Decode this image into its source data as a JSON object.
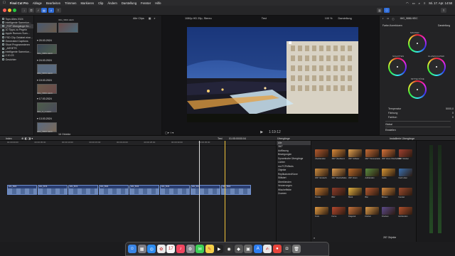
{
  "menubar": {
    "apple": "",
    "app": "Final Cut Pro",
    "menus": [
      "Ablage",
      "Bearbeiten",
      "Trimmen",
      "Markieren",
      "Clip",
      "Ändern",
      "Darstellung",
      "Fenster",
      "Hilfe"
    ],
    "clock": "Mi. 17. Apr. 14:58"
  },
  "toolbar": {
    "share_icon": "share-icon"
  },
  "libraries": {
    "items": [
      {
        "label": "Tops Alles 2024",
        "selected": false
      },
      {
        "label": "Intelligente Sammlun...",
        "selected": false
      },
      {
        "label": "_FCP Übergänge für...",
        "selected": true
      },
      {
        "label": "10 Tipps zu Pegeln",
        "selected": false
      },
      {
        "label": "Apple Rumors Sum...",
        "selected": false
      },
      {
        "label": "FSD Clip Gelabel eine...",
        "selected": false
      },
      {
        "label": "Generated Captions",
        "selected": false
      },
      {
        "label": "Short Programmieren",
        "selected": false
      },
      {
        "label": "_ASSETS",
        "selected": false
      },
      {
        "label": "Intelligente Sammlun...",
        "selected": false
      },
      {
        "label": "2.10.23",
        "selected": false
      },
      {
        "label": "Gesichter",
        "selected": false
      }
    ]
  },
  "browser": {
    "filter": "Alle Clips",
    "dates": [
      "20.03.2024",
      "24.03.2024",
      "15.03.2024",
      "17.03.2024",
      "13.03.2024"
    ],
    "clip_names": [
      "IMG_5883.HEIC",
      "IMG_5870.HEIC",
      "IMG_5866.HEIC",
      "IMG_5_4.HEIC",
      "IMG_5806.HEIC",
      "IMG_5800.HEIC"
    ],
    "clip_count": "16 Objekte"
  },
  "viewer": {
    "format": "1080p HD 25p, Stereo",
    "title": "Test",
    "zoom": "100 %",
    "view": "Darstellung",
    "timecode": "1:19:12"
  },
  "inspector": {
    "clip": "IMG_5886.HEIC",
    "effect": "Farbe-Korrekturen",
    "preset": "Darstellung",
    "wheels": [
      "MASTER",
      "SCHATTEN",
      "MITTELTÖNE",
      "GLANZLICHTER"
    ],
    "rows": [
      {
        "label": "Temperatur",
        "value": "5000,0"
      },
      {
        "label": "Färbung",
        "value": "0"
      },
      {
        "label": "Farbton",
        "value": "0"
      }
    ],
    "sections": [
      "Global",
      "Einstellen"
    ]
  },
  "timeline": {
    "index": "Index",
    "project": "Test",
    "duration": "01:05:00/00:04",
    "ruler": [
      "00:00:00:00",
      "00:00:05:00",
      "00:00:10:00",
      "00:00:15:00",
      "00:00:20:00",
      "00:00:25:00",
      "00:00:30:00",
      "00:00:35:00"
    ],
    "clips": [
      "IMG_5880",
      "IMG_5878",
      "IMG_5870",
      "IMG_5866",
      "IMG_5846",
      "IMG_5836",
      "IMG_5811",
      "IMG_5806"
    ]
  },
  "transitions": {
    "title": "Übergänge",
    "installed": "Installierte Übergänge",
    "count": "287 Objekte",
    "categories": [
      "Alle",
      "360°",
      "Auflösung",
      "Bewegungen",
      "Dynamische Übergänge",
      "Lichter",
      "mo FCPeffects",
      "Objekte",
      "Replikatoren/Klone",
      "Stilisiert",
      "Überblenden",
      "Verzerrungen",
      "Wischeffekte",
      "Zoomen"
    ],
    "items": [
      {
        "name": "Überblenden",
        "color": "#b25a2e"
      },
      {
        "name": "360° Überblend.",
        "color": "#d98a3a"
      },
      {
        "name": "360° Schleier",
        "color": "#e0a050"
      },
      {
        "name": "360° Trümmerteile",
        "color": "#c46b35"
      },
      {
        "name": "360° Zoom Wischeffekt",
        "color": "#d6733a"
      },
      {
        "name": "360° Drehen",
        "color": "#a04030"
      },
      {
        "name": "360° Verwisch.",
        "color": "#ca8b3f"
      },
      {
        "name": "360° Wischeffekte",
        "color": "#d99a4f"
      },
      {
        "name": "360° Zoom",
        "color": "#b86a2a"
      },
      {
        "name": "Aufblenden",
        "color": "#5a8a40"
      },
      {
        "name": "Audio",
        "color": "#d49535"
      },
      {
        "name": "Nach oben",
        "color": "#3a6fae"
      },
      {
        "name": "Punkte",
        "color": "#c47a32"
      },
      {
        "name": "Blitz",
        "color": "#8b3b2a"
      },
      {
        "name": "Block",
        "color": "#e2b040"
      },
      {
        "name": "Blur",
        "color": "#b55a30"
      },
      {
        "name": "Blinken",
        "color": "#d0883d"
      },
      {
        "name": "Fenster",
        "color": "#9a4a2c"
      },
      {
        "name": "Kreis",
        "color": "#e09a42"
      },
      {
        "name": "Kurve",
        "color": "#b5482e"
      },
      {
        "name": "Diagonal",
        "color": "#c6733b"
      },
      {
        "name": "Drehen",
        "color": "#da9a4a"
      },
      {
        "name": "Drucken",
        "color": "#5b4a8a"
      },
      {
        "name": "Einblenden",
        "color": "#b0502c"
      }
    ]
  },
  "dock": {
    "apps": [
      {
        "name": "finder-icon",
        "color": "#3a86e8",
        "glyph": "☺"
      },
      {
        "name": "launchpad-icon",
        "color": "#7d7d85",
        "glyph": "▦"
      },
      {
        "name": "safari-icon",
        "color": "#2d8cf0",
        "glyph": "◎"
      },
      {
        "name": "photos-icon",
        "color": "#e8e8e8",
        "glyph": "✿"
      },
      {
        "name": "calendar-icon",
        "color": "#f4f4f4",
        "glyph": "17"
      },
      {
        "name": "music-icon",
        "color": "#f0455f",
        "glyph": "♪"
      },
      {
        "name": "settings-icon",
        "color": "#8a8a90",
        "glyph": "⚙"
      },
      {
        "name": "messages-icon",
        "color": "#3dcf55",
        "glyph": "✉"
      },
      {
        "name": "notes-icon",
        "color": "#f4d04a",
        "glyph": "✎"
      },
      {
        "name": "finalcut-icon",
        "color": "#222",
        "glyph": "▶"
      },
      {
        "name": "logic-icon",
        "color": "#333",
        "glyph": "◉"
      },
      {
        "name": "motion-icon",
        "color": "#555",
        "glyph": "◆"
      },
      {
        "name": "compressor-icon",
        "color": "#666",
        "glyph": "▣"
      },
      {
        "name": "appstore-icon",
        "color": "#2d7df0",
        "glyph": "A"
      },
      {
        "name": "textedit-icon",
        "color": "#e8e8e8",
        "glyph": "✍"
      },
      {
        "name": "chrome-icon",
        "color": "#e8453c",
        "glyph": "●"
      },
      {
        "name": "screenshot-icon",
        "color": "#444",
        "glyph": "◘"
      },
      {
        "name": "trash-icon",
        "color": "#777",
        "glyph": "🗑"
      }
    ]
  }
}
